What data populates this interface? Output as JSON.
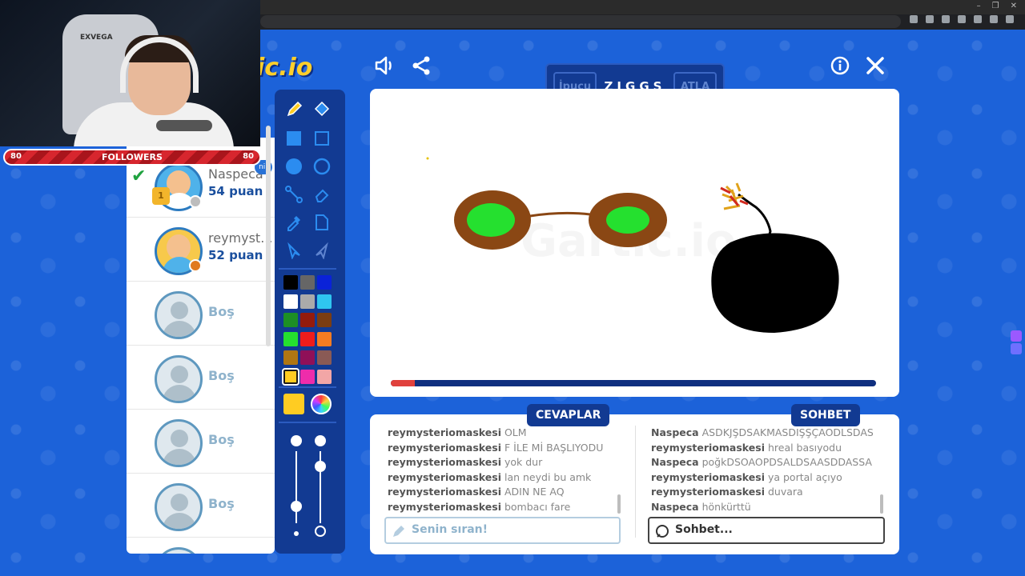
{
  "browser": {
    "window_controls": [
      "–",
      "❐",
      "✕"
    ]
  },
  "stream": {
    "chair_brand": "EXVEGA",
    "followers": {
      "label": "FOLLOWERS",
      "current": "80",
      "goal": "80"
    }
  },
  "app": {
    "logo_text": "ic.io",
    "tab_stub": "nib"
  },
  "top_icons": [
    "sound-icon",
    "share-icon",
    "info-icon",
    "close-icon"
  ],
  "word_panel": {
    "hint_label": "İpucu",
    "word": "ZIGGS",
    "skip_label": "ATLA"
  },
  "players": [
    {
      "name": "Naspeca",
      "score": "54 puan",
      "rank": "1",
      "drawing": true,
      "status_color": "#bdbdbd"
    },
    {
      "name": "reymysteriomaskesi",
      "display_name": "reymyst...",
      "score": "52 puan",
      "status_color": "#e07a1f"
    },
    {
      "name": "Boş",
      "empty": true
    },
    {
      "name": "Boş",
      "empty": true
    },
    {
      "name": "Boş",
      "empty": true
    },
    {
      "name": "Boş",
      "empty": true
    }
  ],
  "palette": {
    "colors": [
      "#000000",
      "#666666",
      "#0a22d8",
      "#ffffff",
      "#aaaaaa",
      "#2fc6f0",
      "#1d8f25",
      "#941b0c",
      "#7a3d12",
      "#25e02f",
      "#ee1c1c",
      "#f57c22",
      "#b07612",
      "#8f1058",
      "#8a5a55",
      "#ffcc22",
      "#ee2cab",
      "#f2a6a6"
    ],
    "selected": "#ffcc22"
  },
  "tools": [
    "pencil-icon",
    "fill-bucket-icon",
    "filled-square-icon",
    "square-outline-icon",
    "filled-circle-icon",
    "circle-outline-icon",
    "line-icon",
    "eraser-icon",
    "eyedropper-icon",
    "new-page-icon",
    "undo-icon",
    "redo-icon"
  ],
  "sliders": {
    "brush_size": 0.25,
    "opacity": 0.85
  },
  "timer": {
    "progress": 0.05
  },
  "canvas": {
    "watermark": "Gartic.io"
  },
  "answers": {
    "title": "CEVAPLAR",
    "messages": [
      {
        "user": "reymysteriomaskesi",
        "text": "OLM"
      },
      {
        "user": "reymysteriomaskesi",
        "text": "F İLE Mİ BAŞLIYODU"
      },
      {
        "user": "reymysteriomaskesi",
        "text": "yok dur"
      },
      {
        "user": "reymysteriomaskesi",
        "text": "lan neydi bu amk"
      },
      {
        "user": "reymysteriomaskesi",
        "text": "ADIN NE AQ"
      },
      {
        "user": "reymysteriomaskesi",
        "text": "bombacı fare"
      }
    ],
    "input_placeholder": "Senin sıran!"
  },
  "chat": {
    "title": "SOHBET",
    "messages": [
      {
        "user": "Naspeca",
        "text": "ASDKJŞDSAKMASDIŞŞÇAODLSDAS"
      },
      {
        "user": "reymysteriomaskesi",
        "text": "hreal basıyodu"
      },
      {
        "user": "Naspeca",
        "text": "poğkDSOAOPDSALDSAASDDASSA"
      },
      {
        "user": "reymysteriomaskesi",
        "text": "ya portal açıyo"
      },
      {
        "user": "reymysteriomaskesi",
        "text": "duvara"
      },
      {
        "user": "Naspeca",
        "text": "hönkürttü"
      }
    ],
    "input_placeholder": "Sohbet..."
  }
}
